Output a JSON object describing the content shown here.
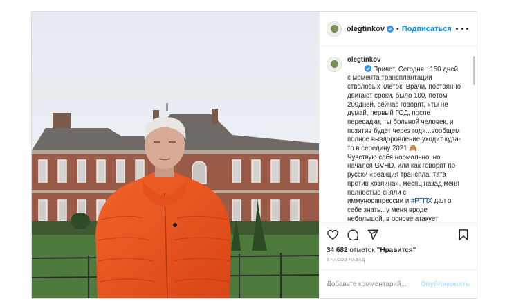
{
  "post": {
    "username": "olegtinkov",
    "follow_label": "Подписаться",
    "dot": "•",
    "caption_username": "olegtinkov",
    "caption_before_hashtag": "Привет. Сегодня +150 дней с момента трансплантации стволовых клеток. Врачи, постоянно двигают сроки, было 100, потом 200дней, сейчас говорят, «ты не думай, первый ГОД, после пересадки, ты больной человек, и позитив будет через год»...вообщем полное выздоровление уходит куда-то в середину 2021 🙈.\nЧувствую себя нормально, но начался GVHD, или как говорят по-русски «реакция трансплантата против хозяина», месяц назад меня полностью сняли с иммуносапрессии и ",
    "hashtag": "#РТПХ",
    "caption_after_hashtag": " дал о себе знать.. у меня вроде небольшой, в основе атакует кишечник, печень и кожу,",
    "likes_count": "34 682",
    "likes_separator": "отметок",
    "likes_label": "\"Нравится\"",
    "time_ago": "3 ЧАСОВ НАЗАД",
    "comment_placeholder": "Добавьте комментарий...",
    "publish_label": "Опубликовать"
  },
  "icons": [
    "verified-badge-icon",
    "more-options-icon",
    "heart-icon",
    "comment-icon",
    "share-icon",
    "bookmark-icon"
  ],
  "colors": {
    "accent": "#0095f6",
    "publish_disabled": "#b2dffc",
    "jacket": "#e8531f",
    "border": "#dbdbdb"
  }
}
